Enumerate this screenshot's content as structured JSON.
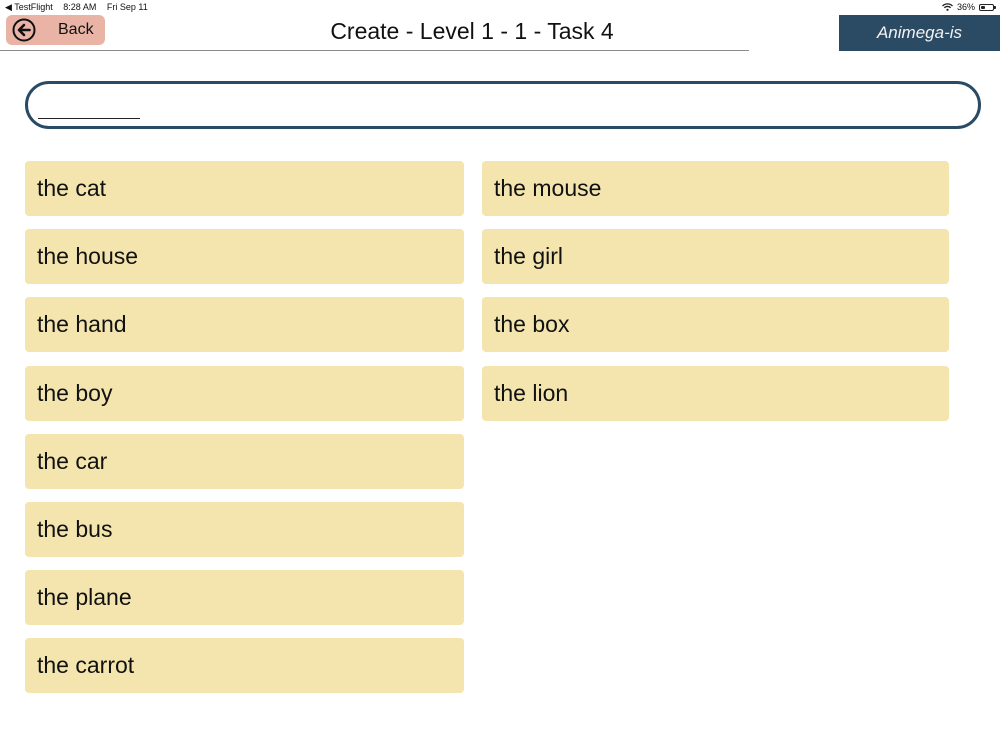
{
  "status_bar": {
    "back_app": "◀ TestFlight",
    "time": "8:28 AM",
    "date": "Fri Sep 11",
    "battery": "36%",
    "battery_level": 0.36
  },
  "header": {
    "back_label": "Back",
    "title": "Create - Level 1 - 1 - Task 4",
    "brand": "Animega-is"
  },
  "answer": {
    "value": ""
  },
  "phrases": {
    "left": [
      "the cat",
      "the house",
      "the hand",
      "the boy",
      "the car",
      "the bus",
      "the plane",
      "the carrot"
    ],
    "right": [
      "the mouse",
      "the girl",
      "the box",
      "the lion"
    ]
  },
  "colors": {
    "accent": "#2b4a63",
    "back_button": "#e9b3a6",
    "tile": "#f3e5ad"
  }
}
